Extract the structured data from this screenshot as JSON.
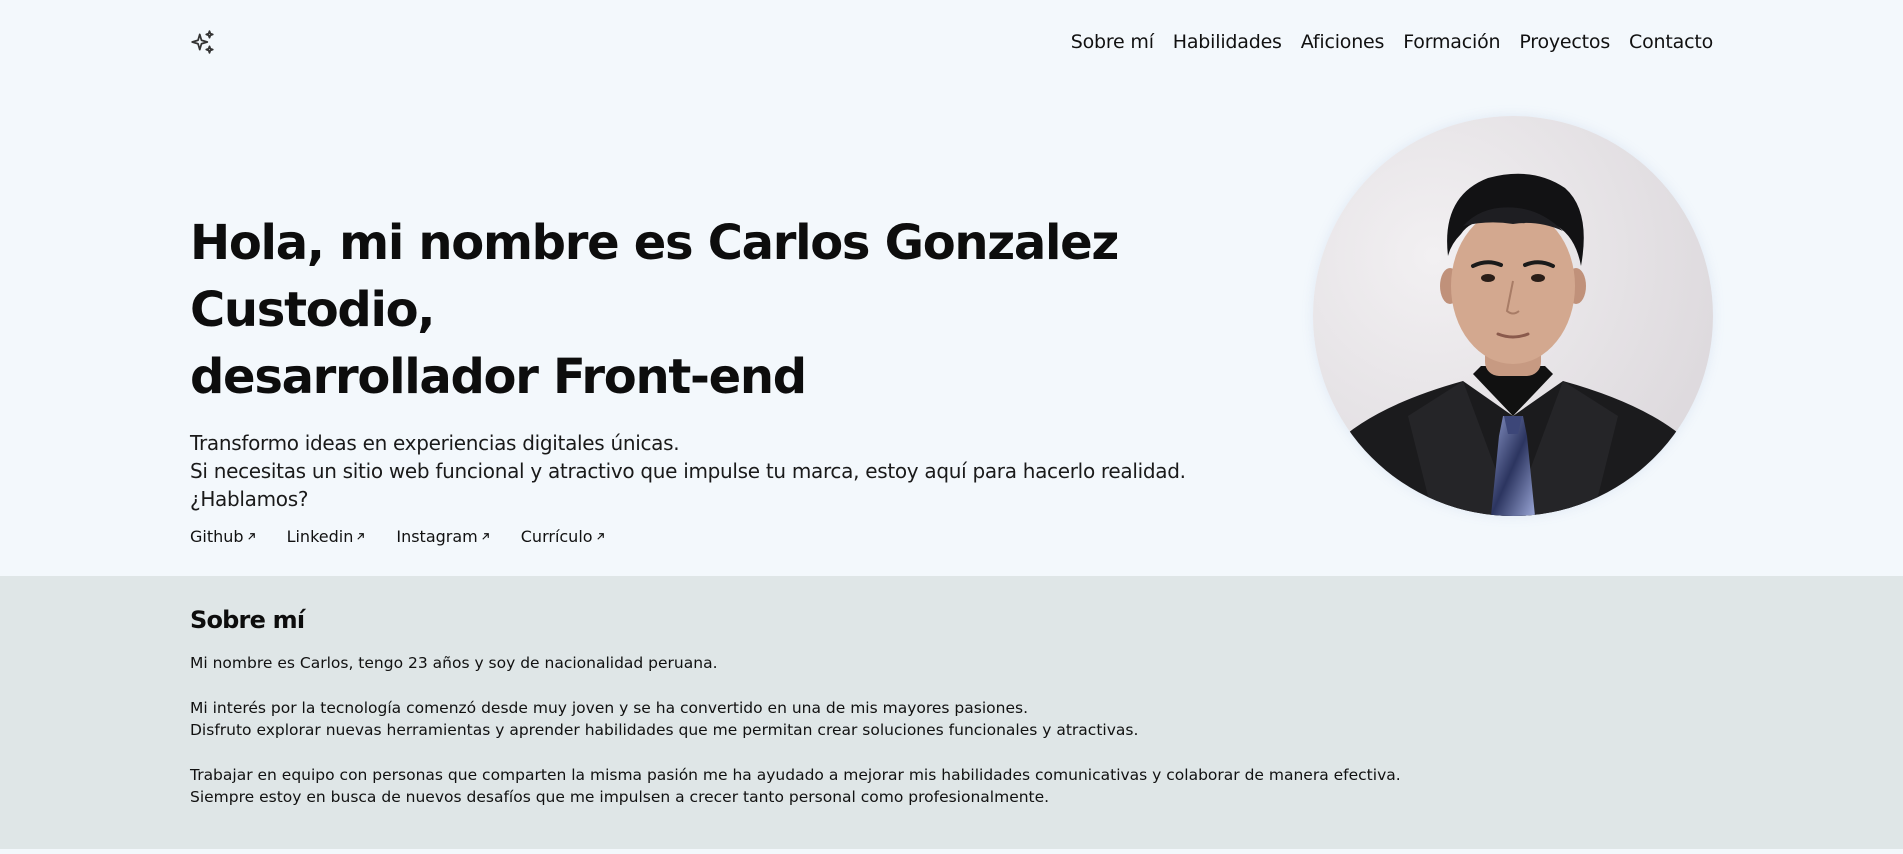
{
  "header": {
    "logo_icon": "sparkles-icon",
    "nav": [
      {
        "label": "Sobre mí"
      },
      {
        "label": "Habilidades"
      },
      {
        "label": "Aficiones"
      },
      {
        "label": "Formación"
      },
      {
        "label": "Proyectos"
      },
      {
        "label": "Contacto"
      }
    ]
  },
  "hero": {
    "title_line1": "Hola, mi nombre es Carlos Gonzalez Custodio,",
    "title_line2": "desarrollador Front-end",
    "desc_line1": "Transformo ideas en experiencias digitales únicas.",
    "desc_line2": "Si necesitas un sitio web funcional y atractivo que impulse tu marca, estoy aquí para hacerlo realidad. ¿Hablamos?",
    "links": [
      {
        "label": "Github",
        "icon": "arrow-up-right-icon"
      },
      {
        "label": "Linkedin",
        "icon": "arrow-up-right-icon"
      },
      {
        "label": "Instagram",
        "icon": "arrow-up-right-icon"
      },
      {
        "label": "Currículo",
        "icon": "arrow-up-right-icon"
      }
    ]
  },
  "about": {
    "title": "Sobre mí",
    "p1": "Mi nombre es Carlos, tengo 23 años y soy de nacionalidad peruana.",
    "p2_line1": "Mi interés por la tecnología comenzó desde muy joven y se ha convertido en una de mis mayores pasiones.",
    "p2_line2": "Disfruto explorar nuevas herramientas y aprender habilidades que me permitan crear soluciones funcionales y atractivas.",
    "p3_line1": "Trabajar en equipo con personas que comparten la misma pasión me ha ayudado a mejorar mis habilidades comunicativas y colaborar de manera efectiva.",
    "p3_line2": "Siempre estoy en busca de nuevos desafíos que me impulsen a crecer tanto personal como profesionalmente."
  },
  "colors": {
    "page_bg": "#f3f8fc",
    "about_bg": "#dfe6e7",
    "text": "#111111"
  }
}
